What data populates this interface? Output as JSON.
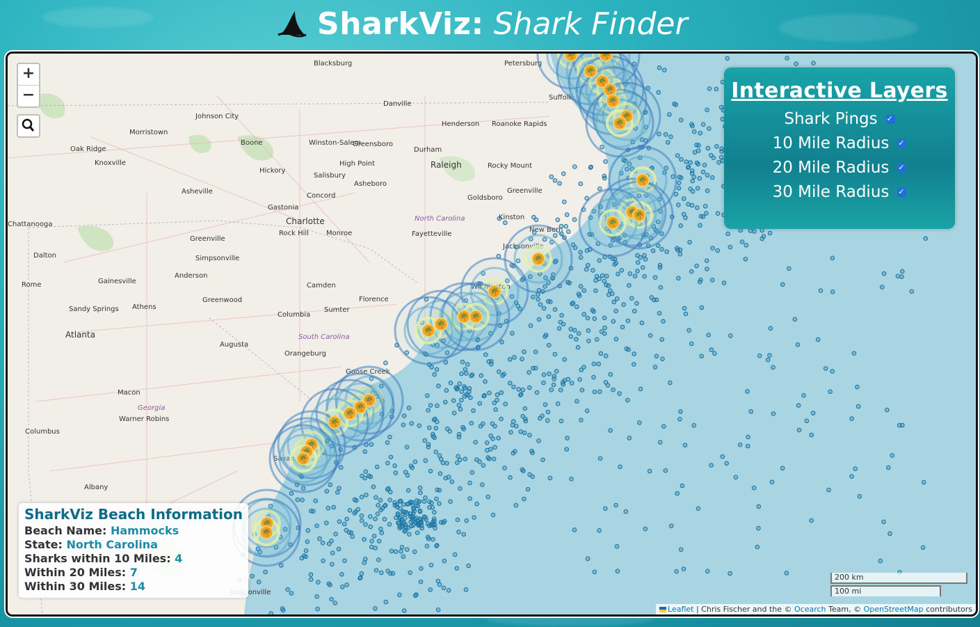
{
  "header": {
    "title": "SharkViz:",
    "subtitle": "Shark Finder"
  },
  "zoom": {
    "in_label": "+",
    "out_label": "−"
  },
  "layers": {
    "title": "Interactive Layers",
    "items": [
      {
        "label": "Shark Pings",
        "checked": true
      },
      {
        "label": "10 Mile Radius",
        "checked": true
      },
      {
        "label": "20 Mile Radius",
        "checked": true
      },
      {
        "label": "30 Mile Radius",
        "checked": true
      }
    ]
  },
  "info": {
    "title": "SharkViz Beach Information",
    "beach_label": "Beach Name:",
    "beach_value": "Hammocks",
    "state_label": "State:",
    "state_value": "North Carolina",
    "r10_label": "Sharks within 10 Miles:",
    "r10_value": "4",
    "r20_label": "Within 20 Miles:",
    "r20_value": "7",
    "r30_label": "Within 30 Miles:",
    "r30_value": "14"
  },
  "scale": {
    "km": "200 km",
    "mi": "100 mi"
  },
  "attribution": {
    "leaflet": "Leaflet",
    "text1": " | Chris Fischer and the © ",
    "ocearch": "Ocearch",
    "text2": " Team, © ",
    "osm": "OpenStreetMap",
    "text3": " contributors"
  },
  "map_labels": [
    {
      "text": "Blacksburg"
    },
    {
      "text": "Petersburg"
    },
    {
      "text": "Danville"
    },
    {
      "text": "Suffolk"
    },
    {
      "text": "Johnson City"
    },
    {
      "text": "Morristown"
    },
    {
      "text": "Oak Ridge"
    },
    {
      "text": "Knoxville"
    },
    {
      "text": "Boone"
    },
    {
      "text": "Winston-Salem"
    },
    {
      "text": "Greensboro"
    },
    {
      "text": "Durham"
    },
    {
      "text": "Henderson"
    },
    {
      "text": "Roanoke Rapids"
    },
    {
      "text": "Raleigh"
    },
    {
      "text": "High Point"
    },
    {
      "text": "Rocky Mount"
    },
    {
      "text": "Hickory"
    },
    {
      "text": "Salisbury"
    },
    {
      "text": "Asheboro"
    },
    {
      "text": "Asheville"
    },
    {
      "text": "Greenville"
    },
    {
      "text": "Concord"
    },
    {
      "text": "Goldsboro"
    },
    {
      "text": "Gastonia"
    },
    {
      "text": "Charlotte"
    },
    {
      "text": "North Carolina"
    },
    {
      "text": "Kinston"
    },
    {
      "text": "Chattanooga"
    },
    {
      "text": "Rock Hill"
    },
    {
      "text": "Monroe"
    },
    {
      "text": "Fayetteville"
    },
    {
      "text": "New Bern"
    },
    {
      "text": "Greenville"
    },
    {
      "text": "Jacksonville"
    },
    {
      "text": "Dalton"
    },
    {
      "text": "Simpsonville"
    },
    {
      "text": "Gainesville"
    },
    {
      "text": "Anderson"
    },
    {
      "text": "Rome"
    },
    {
      "text": "Camden"
    },
    {
      "text": "Greenwood"
    },
    {
      "text": "Sandy Springs"
    },
    {
      "text": "Athens"
    },
    {
      "text": "Florence"
    },
    {
      "text": "Sumter"
    },
    {
      "text": "Columbia"
    },
    {
      "text": "Atlanta"
    },
    {
      "text": "South Carolina"
    },
    {
      "text": "Augusta"
    },
    {
      "text": "Orangeburg"
    },
    {
      "text": "Macon"
    },
    {
      "text": "Georgia"
    },
    {
      "text": "Warner Robins"
    },
    {
      "text": "Columbus"
    },
    {
      "text": "Albany"
    },
    {
      "text": "Wilmington"
    },
    {
      "text": "Jacksonville"
    },
    {
      "text": "Savannah"
    },
    {
      "text": "Goose Creek"
    }
  ]
}
